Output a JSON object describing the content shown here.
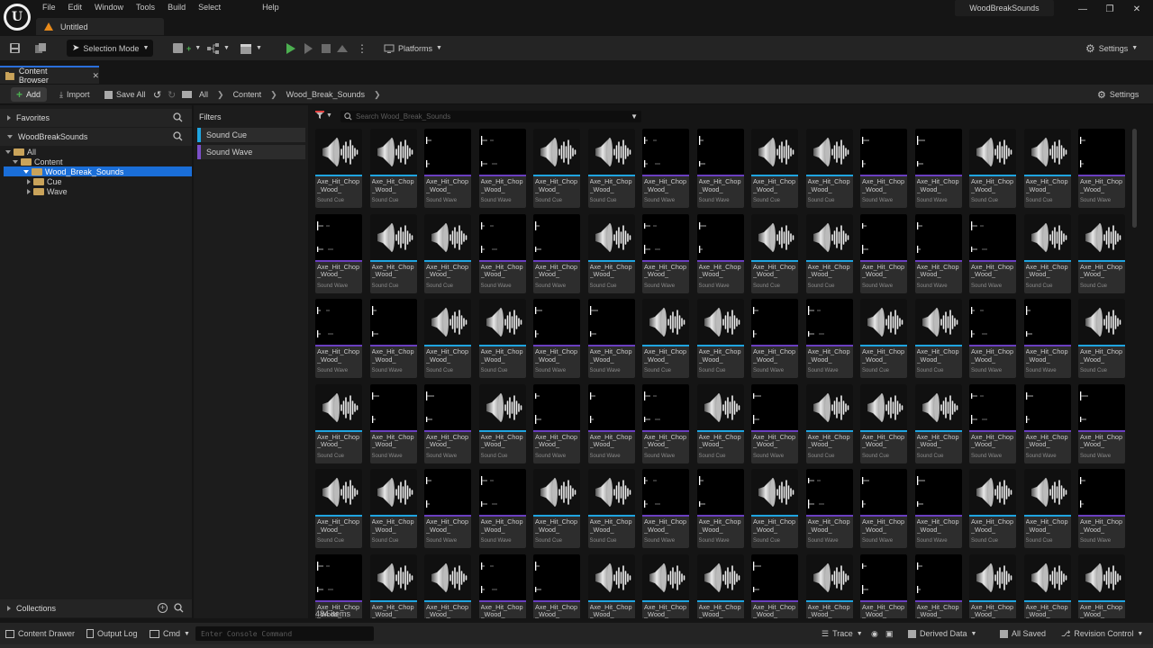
{
  "window": {
    "menu": [
      "File",
      "Edit",
      "Window",
      "Tools",
      "Build",
      "Select",
      "Help"
    ],
    "document_tab": "Untitled",
    "project_name": "WoodBreakSounds"
  },
  "toolbar": {
    "selection_mode": "Selection Mode",
    "platforms": "Platforms",
    "settings": "Settings"
  },
  "content_browser": {
    "tab_label": "Content Browser",
    "add_label": "Add",
    "import_label": "Import",
    "save_all_label": "Save All",
    "breadcrumbs": [
      "All",
      "Content",
      "Wood_Break_Sounds"
    ],
    "settings_label": "Settings",
    "search_placeholder": "Search Wood_Break_Sounds",
    "items_count": "484 items"
  },
  "sources": {
    "favorites": "Favorites",
    "project": "WoodBreakSounds",
    "tree": [
      {
        "label": "All",
        "level": 0
      },
      {
        "label": "Content",
        "level": 1
      },
      {
        "label": "Wood_Break_Sounds",
        "level": 2,
        "selected": true
      },
      {
        "label": "Cue",
        "level": 3
      },
      {
        "label": "Wave",
        "level": 3
      }
    ],
    "collections": "Collections"
  },
  "filters": {
    "title": "Filters",
    "items": [
      {
        "label": "Sound Cue",
        "color": "#1fa4e0"
      },
      {
        "label": "Sound Wave",
        "color": "#7b4fc8"
      }
    ]
  },
  "assets": {
    "name": "Axe_Hit_Chop\n_Wood_",
    "types": {
      "cue": {
        "label": "Sound Cue",
        "color": "#1fa4e0"
      },
      "wave": {
        "label": "Sound Wave",
        "color": "#6a3fc0"
      }
    },
    "rows": [
      "ccwwccwwccwwccw",
      "wccwwcwwccwwwcc",
      "wwccwwccwwccwwc",
      "cwwcwwwcwcccwww",
      "ccwwccwwcwwwccw",
      "wccwwcccwcwwccc"
    ]
  },
  "status": {
    "content_drawer": "Content Drawer",
    "output_log": "Output Log",
    "cmd": "Cmd",
    "console_placeholder": "Enter Console Command",
    "trace": "Trace",
    "derived_data": "Derived Data",
    "all_saved": "All Saved",
    "revision_control": "Revision Control"
  }
}
